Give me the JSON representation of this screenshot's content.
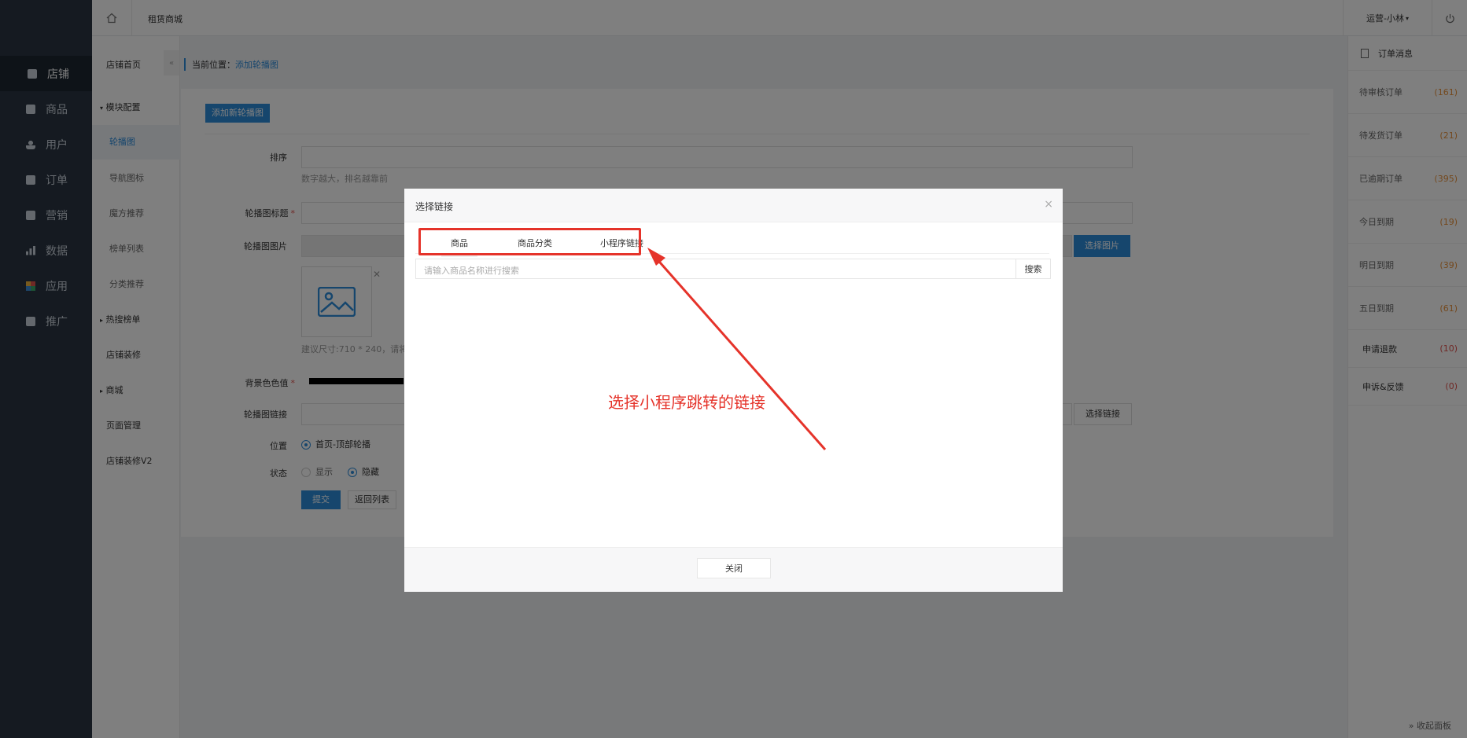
{
  "leftnav": {
    "collapse_glyph": "⇇",
    "items": [
      {
        "label": "店铺",
        "icon": "store-icon"
      },
      {
        "label": "商品",
        "icon": "goods-icon"
      },
      {
        "label": "用户",
        "icon": "user-icon"
      },
      {
        "label": "订单",
        "icon": "order-icon"
      },
      {
        "label": "营销",
        "icon": "gift-icon"
      },
      {
        "label": "数据",
        "icon": "chart-icon"
      },
      {
        "label": "应用",
        "icon": "apps-icon"
      },
      {
        "label": "推广",
        "icon": "promote-icon"
      }
    ]
  },
  "topbar": {
    "brand": "租赁商城",
    "user": "运营-小林",
    "user_caret": "▾"
  },
  "subnav": {
    "shop_home": "店铺首页",
    "toggle_glyph": "«",
    "items": [
      {
        "label": "模块配置",
        "group": true,
        "caret": "▾"
      },
      {
        "label": "轮播图",
        "active": true
      },
      {
        "label": "导航图标"
      },
      {
        "label": "魔方推荐"
      },
      {
        "label": "榜单列表"
      },
      {
        "label": "分类推荐"
      },
      {
        "label": "热搜榜单",
        "group": true,
        "caret": "▸"
      },
      {
        "label": "店铺装修"
      },
      {
        "label": "商城",
        "group": true,
        "caret": "▸"
      },
      {
        "label": "页面管理"
      },
      {
        "label": "店铺装修V2"
      }
    ]
  },
  "breadcrumb": {
    "prefix": "当前位置：",
    "current": "添加轮播图"
  },
  "form": {
    "add_button": "添加新轮播图",
    "sort_label": "排序",
    "sort_help": "数字越大，排名越靠前",
    "title_label": "轮播图标题",
    "image_label": "轮播图图片",
    "choose_image_button": "选择图片",
    "image_remove_glyph": "✕",
    "image_size_help": "建议尺寸:710 * 240，请将",
    "bgcolor_label": "背景色色值",
    "link_label": "轮播图链接",
    "choose_link_button": "选择链接",
    "position_label": "位置",
    "position_option": "首页-顶部轮播",
    "status_label": "状态",
    "status_show": "显示",
    "status_hide": "隐藏",
    "submit_button": "提交",
    "back_button": "返回列表",
    "required_mark": "*"
  },
  "rightpanel": {
    "title": "订单消息",
    "rows": [
      {
        "label": "待审核订单",
        "count": "(161)"
      },
      {
        "label": "待发货订单",
        "count": "(21)"
      },
      {
        "label": "已逾期订单",
        "count": "(395)"
      },
      {
        "label": "今日到期",
        "count": "(19)"
      },
      {
        "label": "明日到期",
        "count": "(39)"
      },
      {
        "label": "五日到期",
        "count": "(61)"
      }
    ],
    "rows2": [
      {
        "label": "申请退款",
        "count": "(10)"
      },
      {
        "label": "申诉&反馈",
        "count": "(0)"
      }
    ],
    "footer": "» 收起面板"
  },
  "modal": {
    "title": "选择链接",
    "close_glyph": "×",
    "tabs": [
      "商品",
      "商品分类",
      "小程序链接"
    ],
    "search_placeholder": "请输入商品名称进行搜索",
    "search_button": "搜索",
    "close_button": "关闭"
  },
  "annotation": {
    "text": "选择小程序跳转的链接",
    "color": "#e5332a"
  }
}
